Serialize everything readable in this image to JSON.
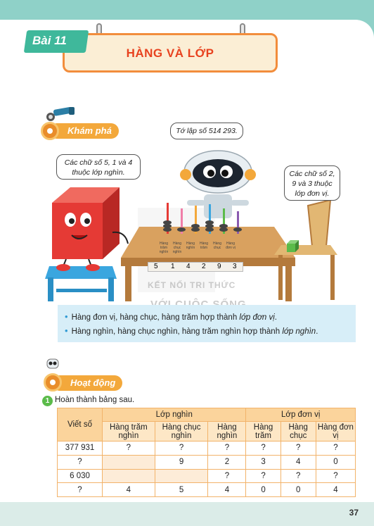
{
  "header": {
    "lesson": "Bài 11",
    "title": "HÀNG VÀ LỚP"
  },
  "sections": {
    "explore": "Khám phá",
    "activity": "Hoạt động"
  },
  "bubbles": {
    "robot": "Tớ lập số 514 293.",
    "cube": "Các chữ số 5, 1 và 4 thuộc lớp nghìn.",
    "small": "Các chữ số 2, 9 và 3 thuộc lớp đơn vị."
  },
  "abacus": {
    "columns": [
      "Hàng trăm nghìn",
      "Hàng chục nghìn",
      "Hàng nghìn",
      "Hàng trăm",
      "Hàng chục",
      "Hàng đơn vị"
    ],
    "digits": [
      "5",
      "1",
      "4",
      "2",
      "9",
      "3"
    ]
  },
  "watermark": {
    "line1": "KẾT NỐI TRI THỨC",
    "line2": "VỚI CUỘC SỐNG"
  },
  "info": {
    "line1_text": "Hàng đơn vị, hàng chục, hàng trăm hợp thành ",
    "line1_em": "lớp đơn vị",
    "line1_end": ".",
    "line2_text": "Hàng nghìn, hàng chục nghìn, hàng trăm nghìn hợp thành ",
    "line2_em": "lớp nghìn",
    "line2_end": "."
  },
  "activity": {
    "number": "1",
    "instruction": "Hoàn thành bảng sau.",
    "table": {
      "col_write": "Viết số",
      "group_thousand": "Lớp nghìn",
      "group_unit": "Lớp đơn vị",
      "sub": [
        "Hàng trăm nghìn",
        "Hàng chục nghìn",
        "Hàng nghìn",
        "Hàng trăm",
        "Hàng chục",
        "Hàng đơn vị"
      ],
      "rows": [
        [
          "377 931",
          "?",
          "?",
          "?",
          "?",
          "?",
          "?"
        ],
        [
          "?",
          "",
          "9",
          "2",
          "3",
          "4",
          "0"
        ],
        [
          "6 030",
          "",
          "",
          "?",
          "?",
          "?",
          "?"
        ],
        [
          "?",
          "4",
          "5",
          "4",
          "0",
          "0",
          "4"
        ]
      ]
    }
  },
  "page_number": "37"
}
